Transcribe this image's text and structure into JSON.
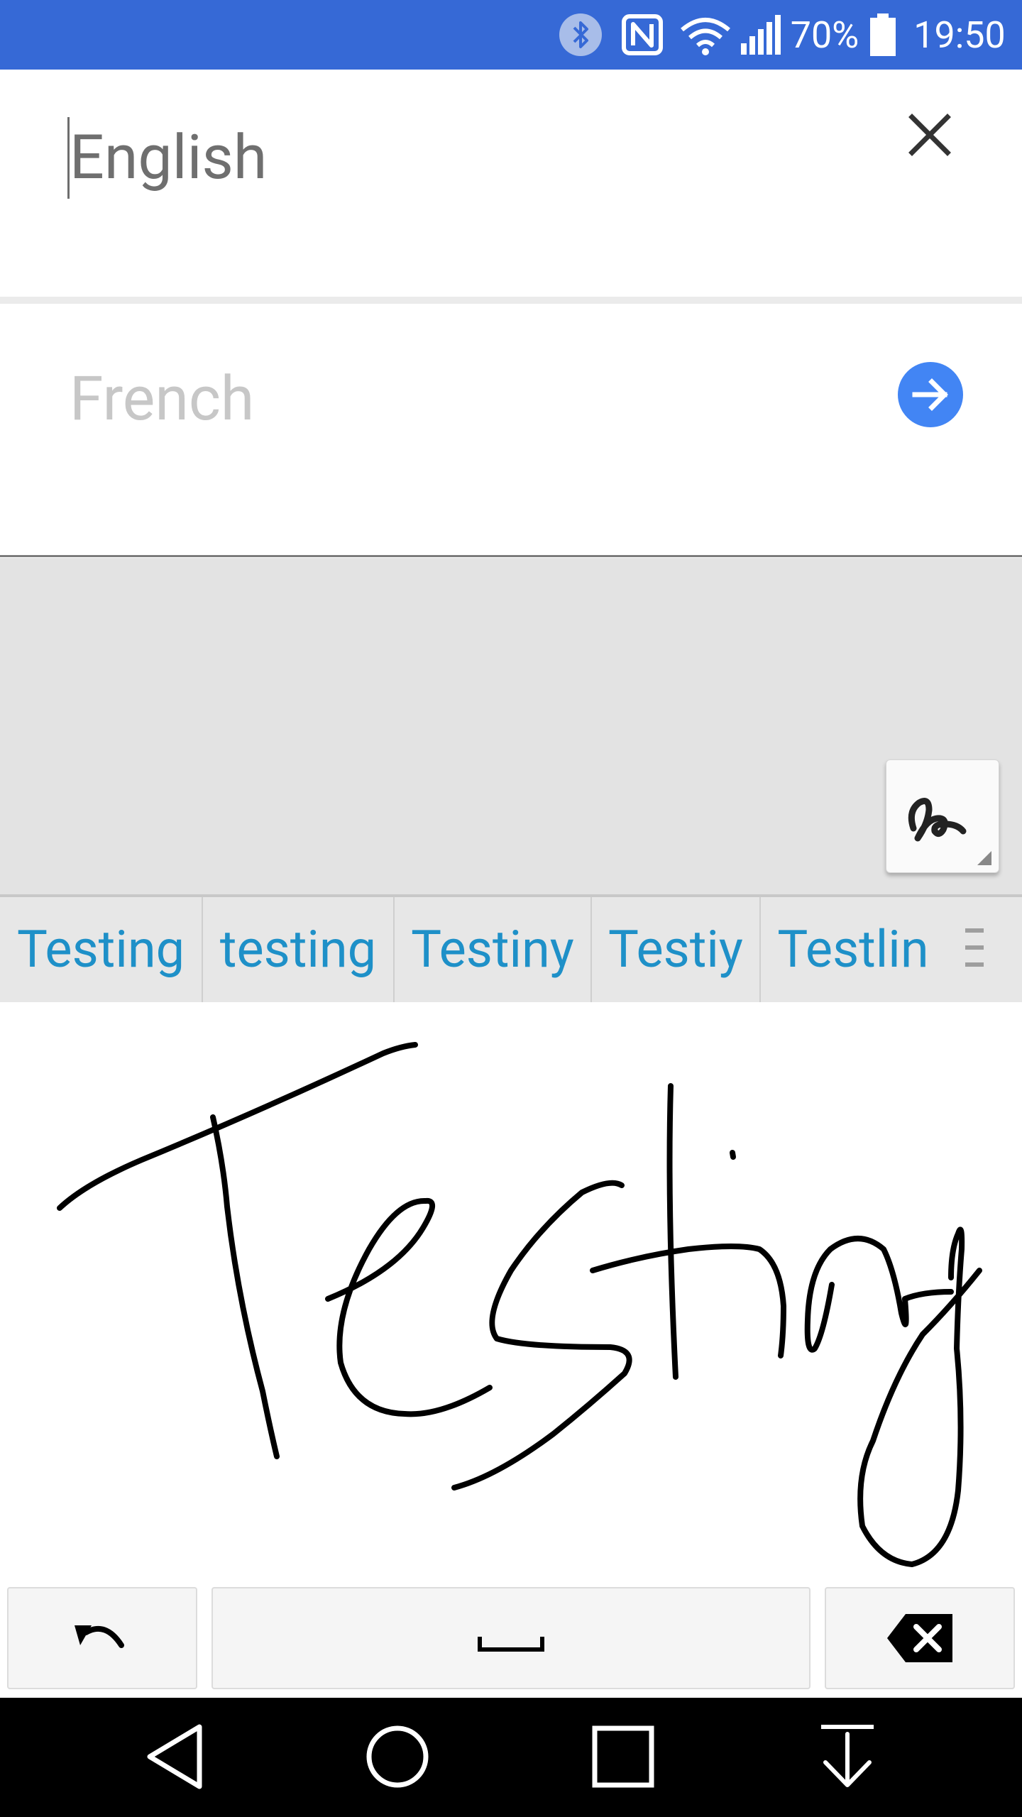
{
  "status_bar": {
    "battery_percent": "70%",
    "time": "19:50",
    "icons": [
      "bluetooth-icon",
      "nfc-icon",
      "wifi-icon",
      "signal-icon",
      "battery-icon"
    ]
  },
  "source": {
    "language_placeholder": "English",
    "close_icon": "close-icon"
  },
  "target": {
    "language_placeholder": "French",
    "go_icon": "arrow-right-icon",
    "accent_color": "#4285f4"
  },
  "handwriting_toggle_icon": "handwriting-icon",
  "suggestions": [
    "Testing",
    "testing",
    "Testiny",
    "Testiy",
    "Testlin"
  ],
  "suggestion_menu_icon": "more-suggestions-icon",
  "keys": {
    "undo_icon": "undo-icon",
    "space_icon": "space-icon",
    "backspace_icon": "backspace-icon"
  },
  "nav": {
    "back_icon": "back-icon",
    "home_icon": "home-icon",
    "recents_icon": "recents-icon",
    "hide_keyboard_icon": "hide-keyboard-icon"
  },
  "colors": {
    "status_bar": "#3669d6",
    "suggestion_text": "#1e90c8"
  }
}
